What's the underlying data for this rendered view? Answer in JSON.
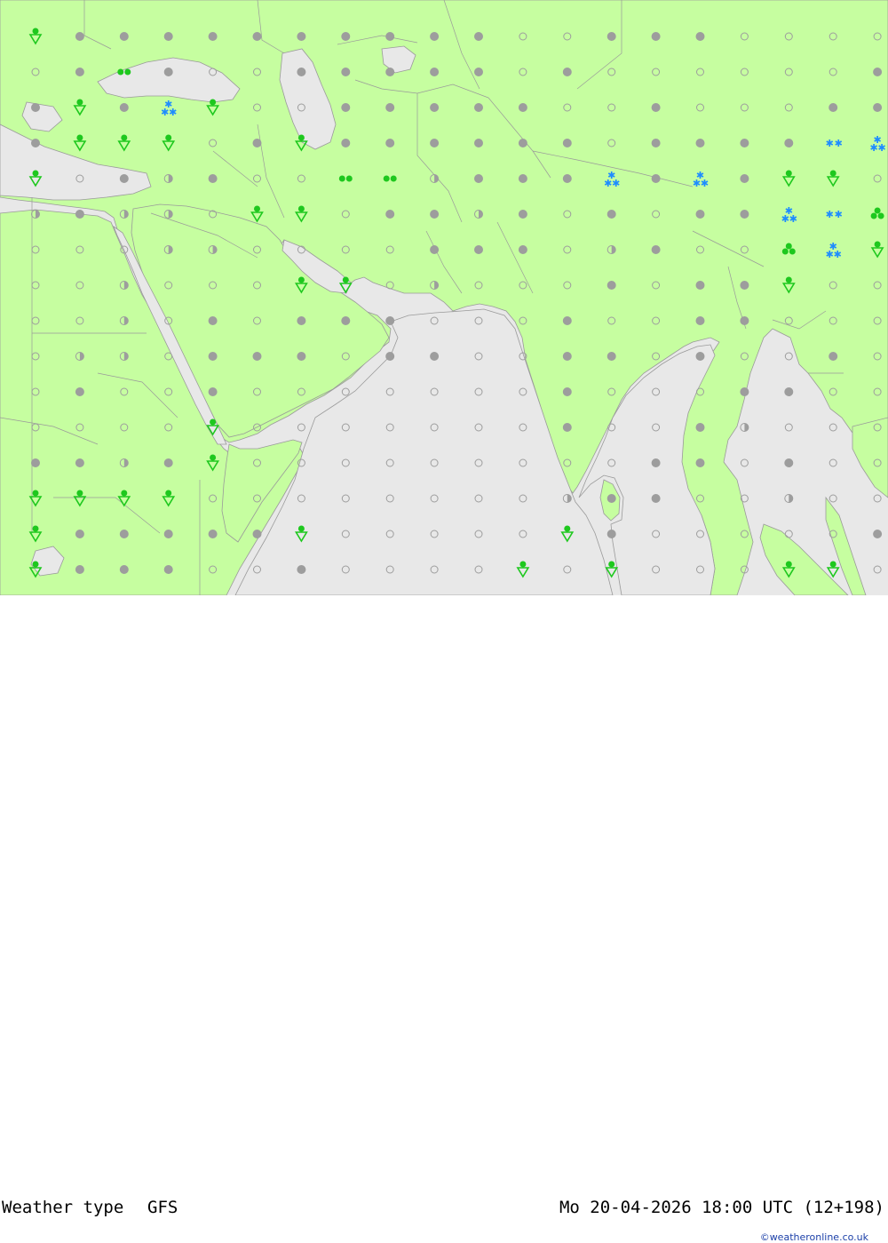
{
  "footer": {
    "label": "Weather type",
    "model": "GFS",
    "datetime": "Mo 20-04-2026 18:00 UTC (12+198)",
    "credit": "©weatheronline.co.uk"
  },
  "colors": {
    "land": "#c6fea0",
    "sea": "#e8e8e8",
    "border": "#9a9a9a",
    "dot": "#9d9d9d",
    "shower": "#1ec81e",
    "snow": "#1e8cff"
  },
  "grid": {
    "cols": 20,
    "rows": 16,
    "rows_symbols": [
      "vo-ooo.oooooooooooo",
      "oooooooooooooooooooo"
    ]
  }
}
